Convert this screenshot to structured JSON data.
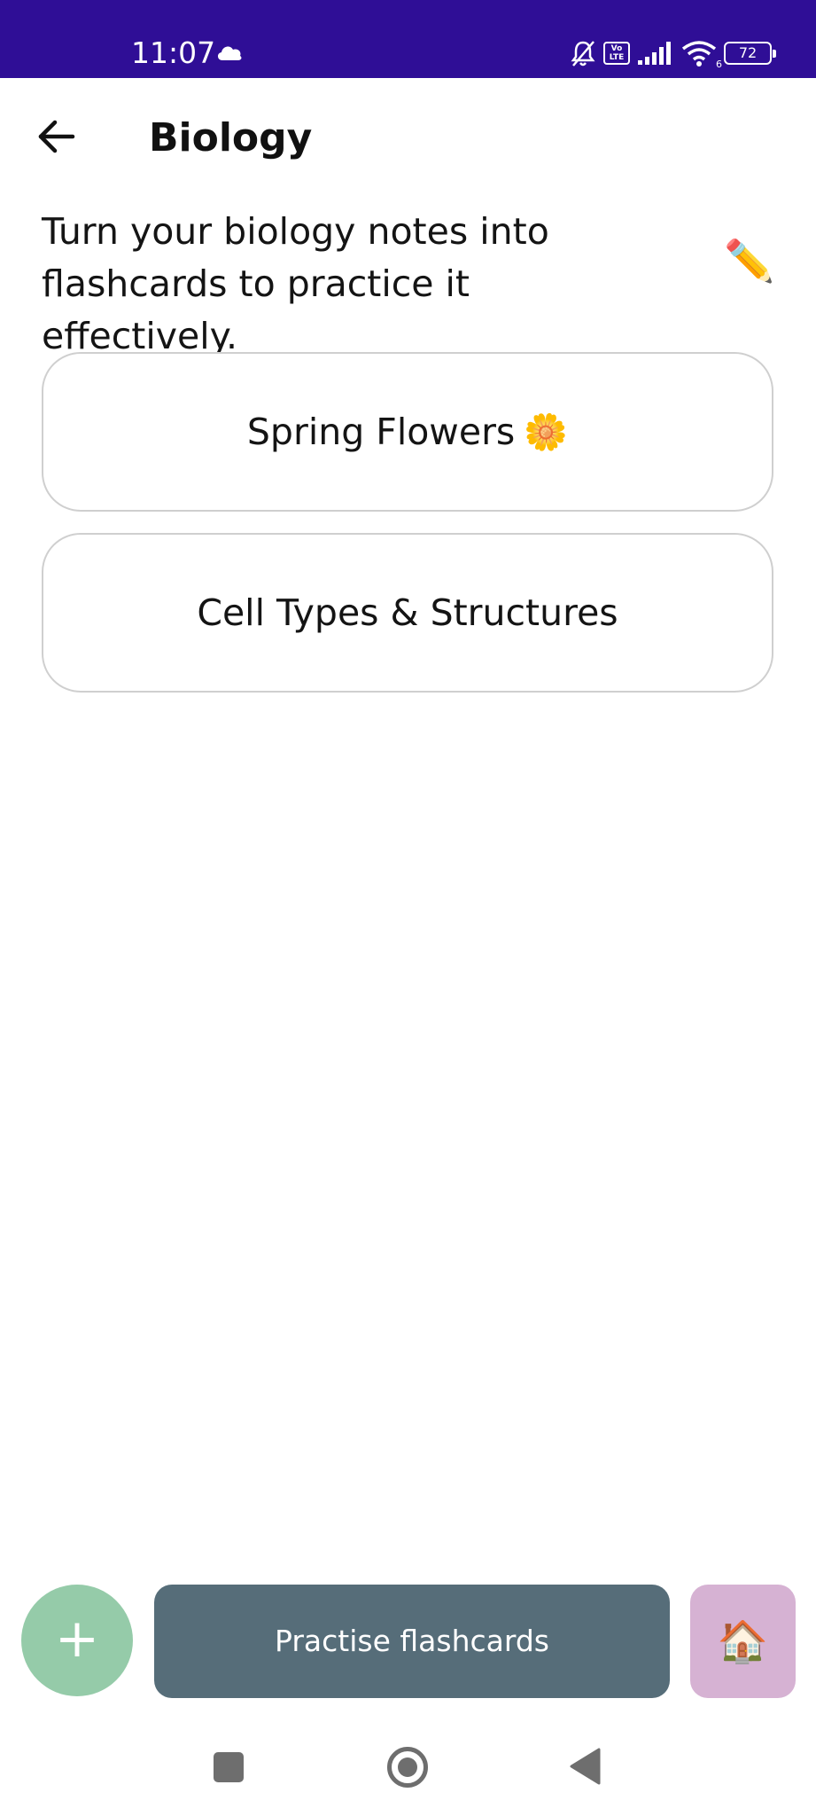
{
  "status_bar": {
    "time": "11:07",
    "battery_level": "72",
    "weather_icon": "cloud-icon",
    "indicators": [
      "bell-muted-icon",
      "volte-icon",
      "cell-signal-icon",
      "wifi-icon",
      "battery-icon"
    ],
    "volte_label": "Vo LTE",
    "wifi_badge": "6",
    "background_color": "#2f0e96"
  },
  "header": {
    "back_icon": "arrow-left-icon",
    "title": "Biology"
  },
  "description": {
    "text": "Turn your biology notes into flashcards to practice it effectively.",
    "edit_icon": "✏️"
  },
  "decks": [
    {
      "label": "Spring Flowers",
      "emoji": "🌼"
    },
    {
      "label": "Cell Types & Structures",
      "emoji": ""
    }
  ],
  "actions": {
    "add_label": "+",
    "practise_label": "Practise flashcards",
    "home_icon": "🏠",
    "colors": {
      "add": "#95cba9",
      "practise": "#566d79",
      "home": "#d6b2d3"
    }
  },
  "system_nav": {
    "buttons": [
      "recents-icon",
      "home-icon",
      "back-icon"
    ]
  }
}
